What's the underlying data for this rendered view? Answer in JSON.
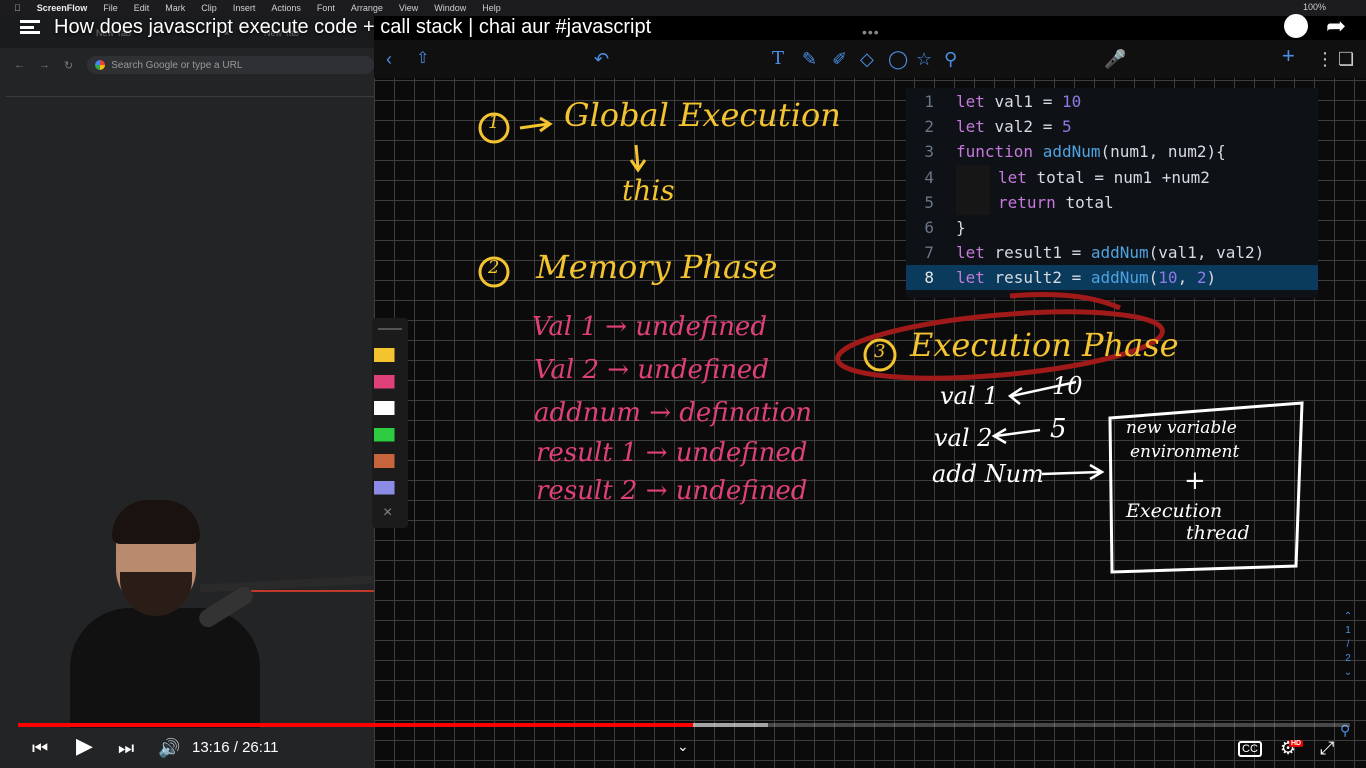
{
  "video": {
    "title": "How does javascript execute code + call stack | chai aur #javascript",
    "time_current": "13:16",
    "time_total": "26:11",
    "progress": 0.507
  },
  "menubar": {
    "app": "ScreenFlow",
    "items": [
      "File",
      "Edit",
      "Mark",
      "Clip",
      "Insert",
      "Actions",
      "Font",
      "Arrange",
      "View",
      "Window",
      "Help"
    ],
    "battery": "100%"
  },
  "browser": {
    "tabs": [
      "New Tab",
      "New Tab"
    ],
    "address_placeholder": "Search Google or type a URL"
  },
  "code": {
    "lines": [
      {
        "n": "1",
        "parts": [
          [
            "kw",
            "let "
          ],
          [
            "txt",
            "val1 = "
          ],
          [
            "num",
            "10"
          ]
        ]
      },
      {
        "n": "2",
        "parts": [
          [
            "kw",
            "let "
          ],
          [
            "txt",
            "val2 = "
          ],
          [
            "num",
            "5"
          ]
        ]
      },
      {
        "n": "3",
        "parts": [
          [
            "kw",
            "function "
          ],
          [
            "fn",
            "addNum"
          ],
          [
            "txt",
            "(num1, num2){"
          ]
        ]
      },
      {
        "n": "4",
        "indent": true,
        "parts": [
          [
            "kw",
            "let "
          ],
          [
            "txt",
            "total = num1 +num2"
          ]
        ]
      },
      {
        "n": "5",
        "indent": true,
        "parts": [
          [
            "kw",
            "return "
          ],
          [
            "txt",
            "total"
          ]
        ]
      },
      {
        "n": "6",
        "parts": [
          [
            "txt",
            "}"
          ]
        ]
      },
      {
        "n": "7",
        "parts": [
          [
            "kw",
            "let "
          ],
          [
            "txt",
            "result1 = "
          ],
          [
            "fn",
            "addNum"
          ],
          [
            "txt",
            "(val1, val2)"
          ]
        ]
      },
      {
        "n": "8",
        "active": true,
        "parts": [
          [
            "kw",
            "let "
          ],
          [
            "txt",
            "result2 = "
          ],
          [
            "fn",
            "addNum"
          ],
          [
            "txt",
            "("
          ],
          [
            "num",
            "10"
          ],
          [
            "txt",
            ", "
          ],
          [
            "num",
            "2"
          ],
          [
            "txt",
            ")"
          ]
        ]
      }
    ]
  },
  "notes": {
    "global": {
      "num": "1",
      "label": "Global Execution",
      "sub": "this"
    },
    "memory": {
      "num": "2",
      "label": "Memory Phase",
      "items": [
        "Val 1 → undefined",
        "Val 2 → undefined",
        "addnum → defination",
        "result 1 → undefined",
        "result 2 → undefined"
      ]
    },
    "execution": {
      "num": "3",
      "label": "Execution Phase",
      "lines": [
        {
          "name": "val 1",
          "value": "10"
        },
        {
          "name": "val 2",
          "value": "5"
        },
        {
          "name": "add Num",
          "value": ""
        }
      ],
      "box": {
        "line1": "new variable",
        "line2": "environment",
        "plus": "+",
        "line3": "Execution",
        "line4": "thread"
      }
    }
  },
  "palette": {
    "colors": [
      "#f4c430",
      "#e0407a",
      "#ffffff",
      "#2ecc40",
      "#c8643c",
      "#8c8ce6"
    ]
  },
  "pager": {
    "current": "1",
    "total": "2"
  },
  "colors": {
    "accent": "#4a8fe7",
    "progress": "#ff0000"
  }
}
